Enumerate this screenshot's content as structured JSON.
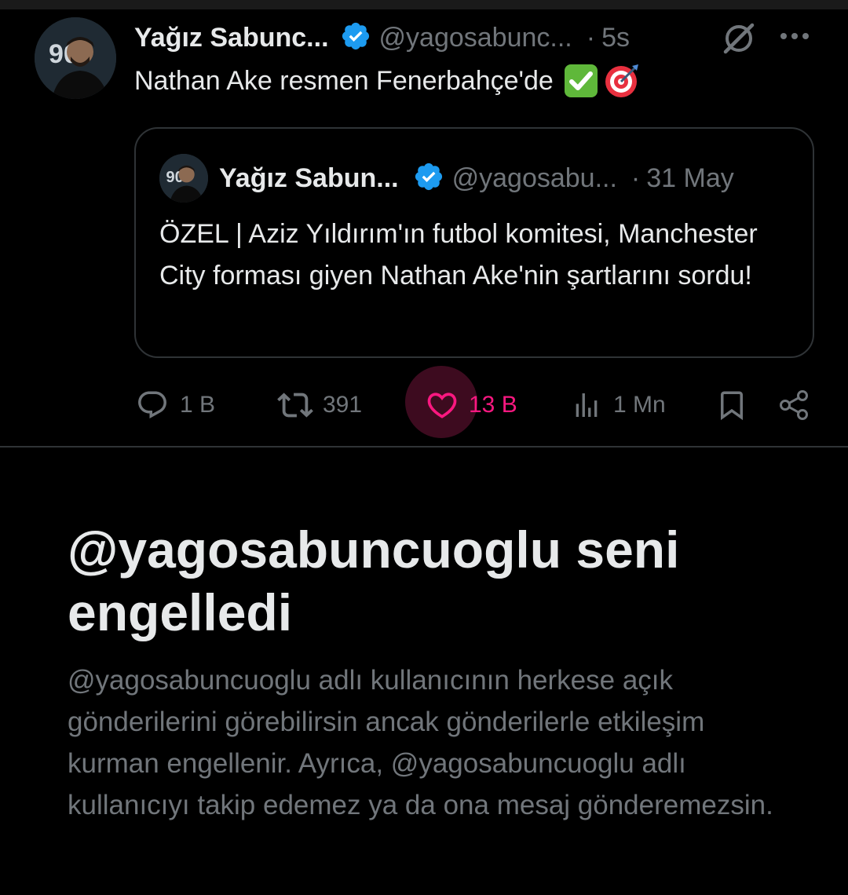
{
  "tweet": {
    "author_name": "Yağız Sabunc...",
    "author_handle": "@yagosabunc...",
    "separator": "·",
    "time": "5s",
    "text": "Nathan Ake resmen Fenerbahçe'de",
    "emojis": [
      "check-mark-button-icon",
      "direct-hit-target-icon"
    ]
  },
  "quoted_tweet": {
    "author_name": "Yağız Sabun...",
    "author_handle": "@yagosabu...",
    "separator": "·",
    "date": "31 May",
    "text": "ÖZEL | Aziz Yıldırım'ın futbol komitesi, Manchester City forması giyen Nathan Ake'nin şartlarını sordu!"
  },
  "actions": {
    "replies": "1 B",
    "reposts": "391",
    "likes": "13 B",
    "views": "1 Mn",
    "icons": [
      "reply-icon",
      "repost-icon",
      "like-icon",
      "views-icon",
      "bookmark-icon",
      "share-icon"
    ]
  },
  "blocked_notice": {
    "title": "@yagosabuncuoglu seni engelledi",
    "description": "@yagosabuncuoglu adlı kullanıcının herkese açık gönderilerini görebilirsin ancak gönderilerle etkileşim kurman engellenir. Ayrıca, @yagosabuncuoglu adlı kullanıcıyı takip edemez ya da ona mesaj gönderemezsin."
  },
  "colors": {
    "background": "#000000",
    "text_primary": "#e7e9ea",
    "text_secondary": "#71767b",
    "verified_blue": "#1d9bf0",
    "like_pink": "#f91880",
    "border": "#2f3336"
  }
}
